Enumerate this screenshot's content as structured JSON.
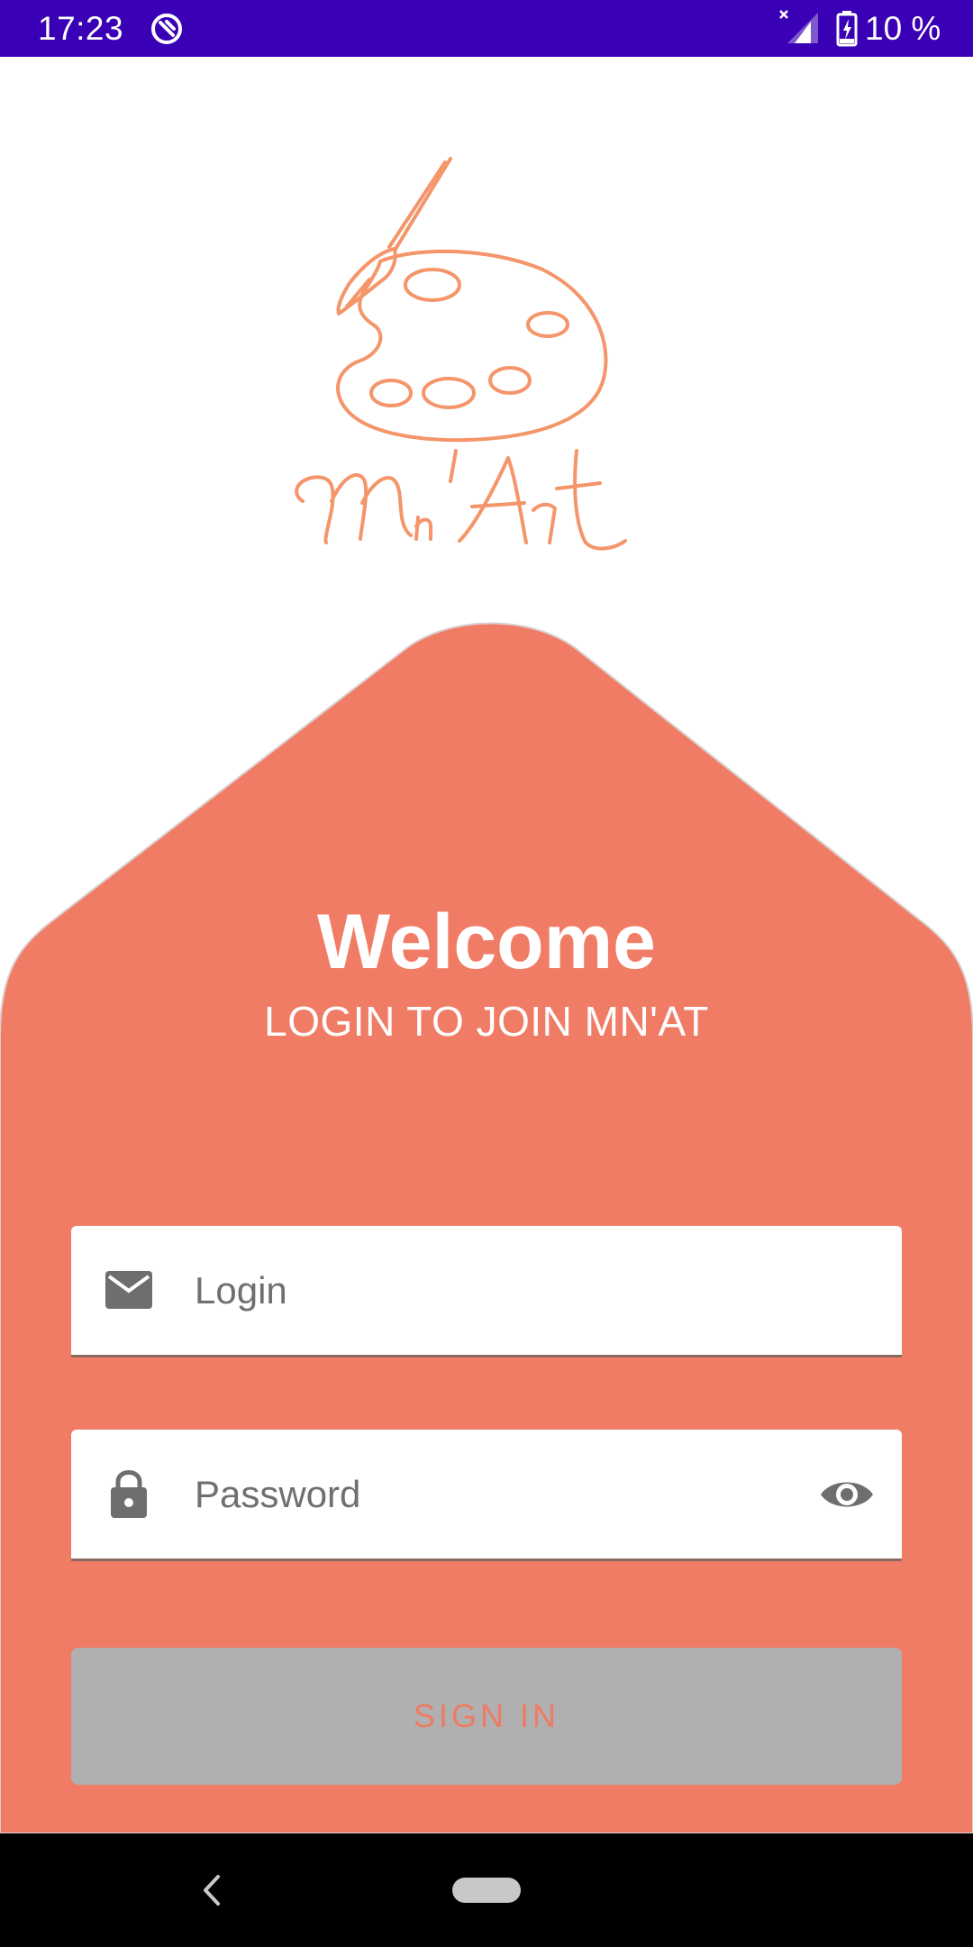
{
  "status_bar": {
    "time": "17:23",
    "battery": "10 %",
    "background_color": "#3a00b5",
    "icons": [
      "app-notification-icon",
      "signal-no-data-icon",
      "battery-charging-icon"
    ]
  },
  "logo": {
    "text": "Mn'Art",
    "color": "#f4956a",
    "icon": "palette-brush-icon"
  },
  "card": {
    "color": "#f17c66"
  },
  "welcome": {
    "title": "Welcome",
    "subtitle": "LOGIN TO JOIN MN'AT"
  },
  "login_field": {
    "placeholder": "Login",
    "value": "",
    "icon": "email-icon"
  },
  "password_field": {
    "placeholder": "Password",
    "value": "",
    "icon": "lock-icon",
    "toggle_icon": "eye-icon"
  },
  "sign_in": {
    "label": "SIGN IN",
    "enabled": false
  },
  "nav_bar": {
    "icons": [
      "back-icon",
      "home-pill-icon"
    ]
  }
}
